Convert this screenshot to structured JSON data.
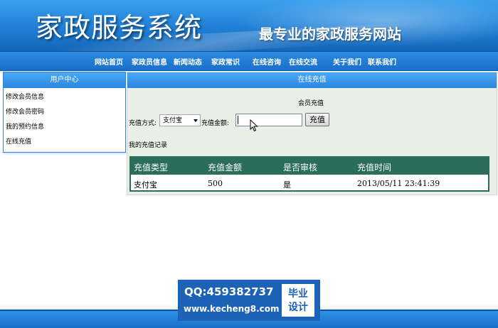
{
  "header": {
    "title": "家政服务系统",
    "slogan": "最专业的家政服务网站"
  },
  "nav": {
    "items": [
      "网站首页",
      "家政员信息",
      "新闻动态",
      "家政常识",
      "在线咨询",
      "在线交流",
      "关于我们",
      "联系我们"
    ]
  },
  "sidebar": {
    "title": "用户中心",
    "items": [
      "修改会员信息",
      "修改会员密码",
      "我的预约信息",
      "在线充值"
    ]
  },
  "main": {
    "title": "在线充值",
    "subtitle": "会员充值",
    "method_label": "充值方式:",
    "method_value": "支付宝",
    "amount_label": "充值金额:",
    "amount_value": "",
    "submit_label": "充值",
    "records_label": "我的充值记录"
  },
  "records": {
    "headers": [
      "充值类型",
      "充值金额",
      "是否审核",
      "充值时间"
    ],
    "rows": [
      [
        "支付宝",
        "500",
        "是",
        "2013/05/11 23:41:39"
      ]
    ]
  },
  "watermark": {
    "qq": "QQ:459382737",
    "url": "www.kecheng8.com",
    "badge_line1": "毕业",
    "badge_line2": "设计"
  },
  "colors": {
    "banner_blue": "#1f7fd6",
    "table_header_green": "#2a6d5a",
    "main_panel_bg": "#e9eee6"
  }
}
